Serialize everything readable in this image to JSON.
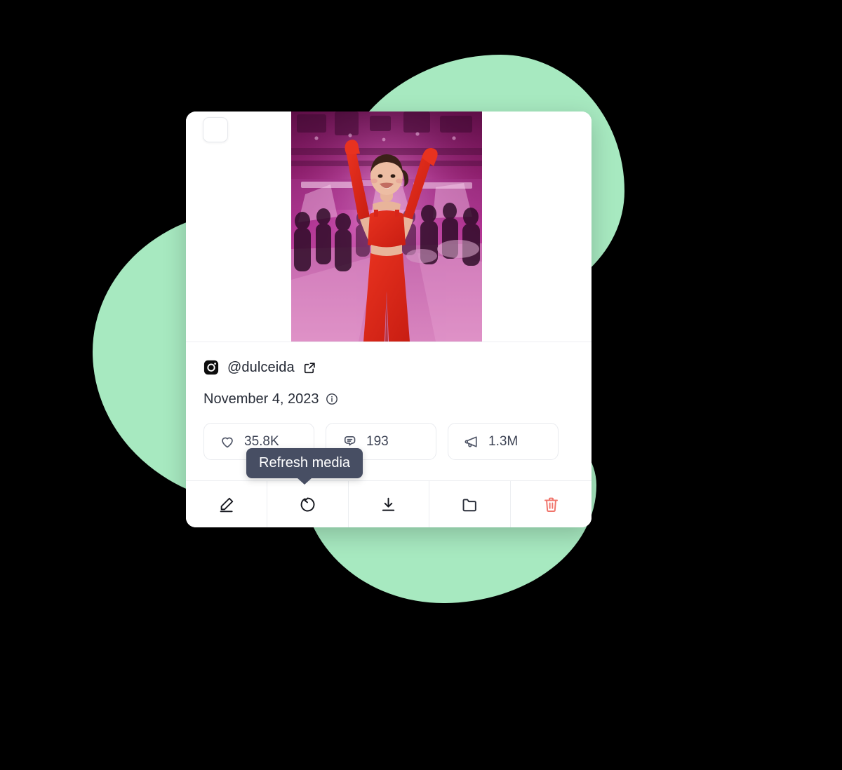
{
  "theme": {
    "page_background": "#000000",
    "blob_color": "#a7e9c0",
    "card_background": "#ffffff",
    "tooltip_background": "#474e63",
    "danger_color": "#f0736a",
    "text_color": "#2a2f3a"
  },
  "card": {
    "checkbox": {
      "name": "select-media-checkbox",
      "checked": false
    },
    "media": {
      "alt": "Woman in red outfit with arms raised at a magenta-lit arena event",
      "platform_icon": "instagram-icon"
    },
    "account": {
      "handle": "@dulceida",
      "external_link_icon": "external-link-icon"
    },
    "date": {
      "text": "November 4, 2023",
      "info_icon": "info-circle-icon"
    },
    "stats": [
      {
        "key": "likes",
        "icon": "heart-icon",
        "value": "35.8K"
      },
      {
        "key": "comments",
        "icon": "comment-icon",
        "value": "193"
      },
      {
        "key": "reach",
        "icon": "megaphone-icon",
        "value": "1.3M"
      }
    ],
    "tooltip": {
      "text": "Refresh media"
    },
    "actions": [
      {
        "key": "edit",
        "icon": "pencil-icon",
        "label": "Edit"
      },
      {
        "key": "refresh",
        "icon": "refresh-icon",
        "label": "Refresh media"
      },
      {
        "key": "download",
        "icon": "download-icon",
        "label": "Download"
      },
      {
        "key": "folder",
        "icon": "folder-icon",
        "label": "Move to folder"
      },
      {
        "key": "delete",
        "icon": "trash-icon",
        "label": "Delete"
      }
    ]
  }
}
